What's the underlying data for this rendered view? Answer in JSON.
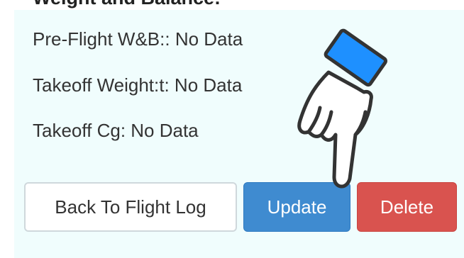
{
  "section": {
    "title": "Weight and Balance:"
  },
  "fields": {
    "pre_flight_wb": "Pre-Flight W&B:: No Data",
    "takeoff_weight": "Takeoff Weight:t: No Data",
    "takeoff_cg": "Takeoff Cg: No Data"
  },
  "buttons": {
    "back_label": "Back To Flight Log",
    "update_label": "Update",
    "delete_label": "Delete"
  },
  "colors": {
    "panel_bg": "#f0fdfd",
    "update_bg": "#3f8bd0",
    "delete_bg": "#d9534f",
    "cuff": "#1e90ff"
  },
  "icons": {
    "pointer": "pointing-hand-icon"
  }
}
